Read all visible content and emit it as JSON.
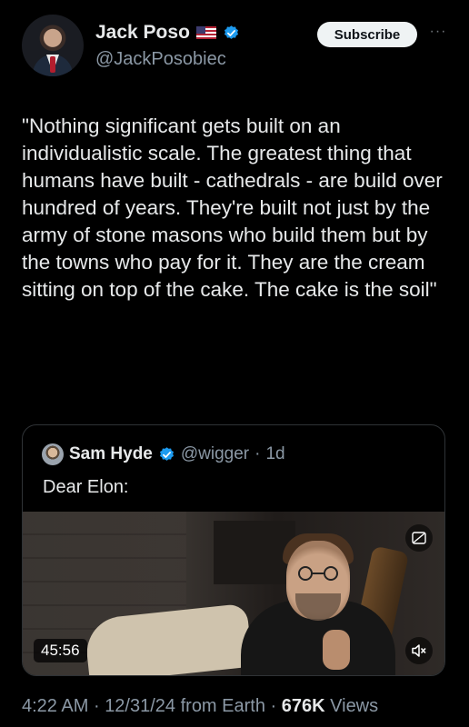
{
  "tweet": {
    "author": {
      "display_name": "Jack Poso",
      "handle": "@JackPosobiec",
      "flag_icon": "us-flag-icon",
      "verified_icon": "verified-badge-icon"
    },
    "subscribe_label": "Subscribe",
    "more_label": "···",
    "text": "\"Nothing significant gets built on an individualistic scale. The greatest thing that humans have built - cathedrals - are build over hundred of years. They're built not just by the army of stone masons who build them but by the towns who pay for it. They are the cream sitting on top of the cake. The cake is the soil\"",
    "meta": {
      "time": "4:22 AM",
      "separator": "·",
      "date": "12/31/24 from Earth",
      "views_count": "676K",
      "views_label": "Views"
    }
  },
  "quote": {
    "author": {
      "display_name": "Sam Hyde",
      "handle": "@wigger",
      "separator": "·",
      "age": "1d"
    },
    "text": "Dear Elon:",
    "video": {
      "duration": "45:56",
      "mute_icon": "volume-muted-icon",
      "cc_icon": "captions-icon"
    }
  },
  "colors": {
    "background": "#000000",
    "text_primary": "#e7e9ea",
    "text_secondary": "#8b98a5",
    "verified_blue": "#1d9bf0",
    "border": "#2f3336"
  }
}
